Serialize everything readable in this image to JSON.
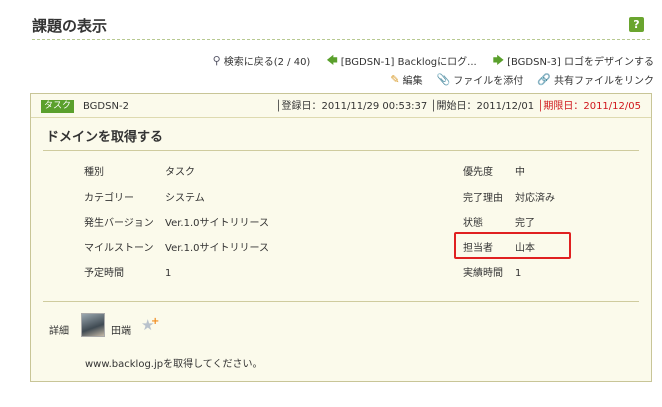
{
  "page": {
    "title": "課題の表示",
    "help_label": "?"
  },
  "nav": {
    "back_to_search": "検索に戻る(2 / 40)",
    "prev_issue": "[BGDSN-1] Backlogにログ...",
    "next_issue": "[BGDSN-3] ロゴをデザインする",
    "back_icon": "magnifier-icon",
    "prev_icon": "arrow-left-icon",
    "next_icon": "arrow-right-icon"
  },
  "actions": {
    "edit": "編集",
    "attach_file": "ファイルを添付",
    "link_shared_file": "共有ファイルをリンク"
  },
  "issue": {
    "type_badge": "タスク",
    "key": "BGDSN-2",
    "registered_date": "│登録日：2011/11/29 00:53:37",
    "start_date": "│開始日：2011/12/01",
    "due_date": "│期限日：2011/12/05",
    "summary": "ドメインを取得する",
    "properties_left": [
      {
        "label": "種別",
        "value": "タスク"
      },
      {
        "label": "カテゴリー",
        "value": "システム"
      },
      {
        "label": "発生バージョン",
        "value": "Ver.1.0サイトリリース"
      },
      {
        "label": "マイルストーン",
        "value": "Ver.1.0サイトリリース"
      },
      {
        "label": "予定時間",
        "value": "1"
      }
    ],
    "properties_right": [
      {
        "label": "優先度",
        "value": "中"
      },
      {
        "label": "完了理由",
        "value": "対応済み"
      },
      {
        "label": "状態",
        "value": "完了"
      },
      {
        "label": "担当者",
        "value": "山本"
      },
      {
        "label": "実績時間",
        "value": "1"
      }
    ],
    "detail_label": "詳細",
    "author": "田端",
    "description": "www.backlog.jpを取得してください。"
  },
  "colors": {
    "accent_green": "#5aa02c",
    "due_red": "#d0161b",
    "highlight_red": "#e02020",
    "box_bg": "#fbfaeb"
  }
}
